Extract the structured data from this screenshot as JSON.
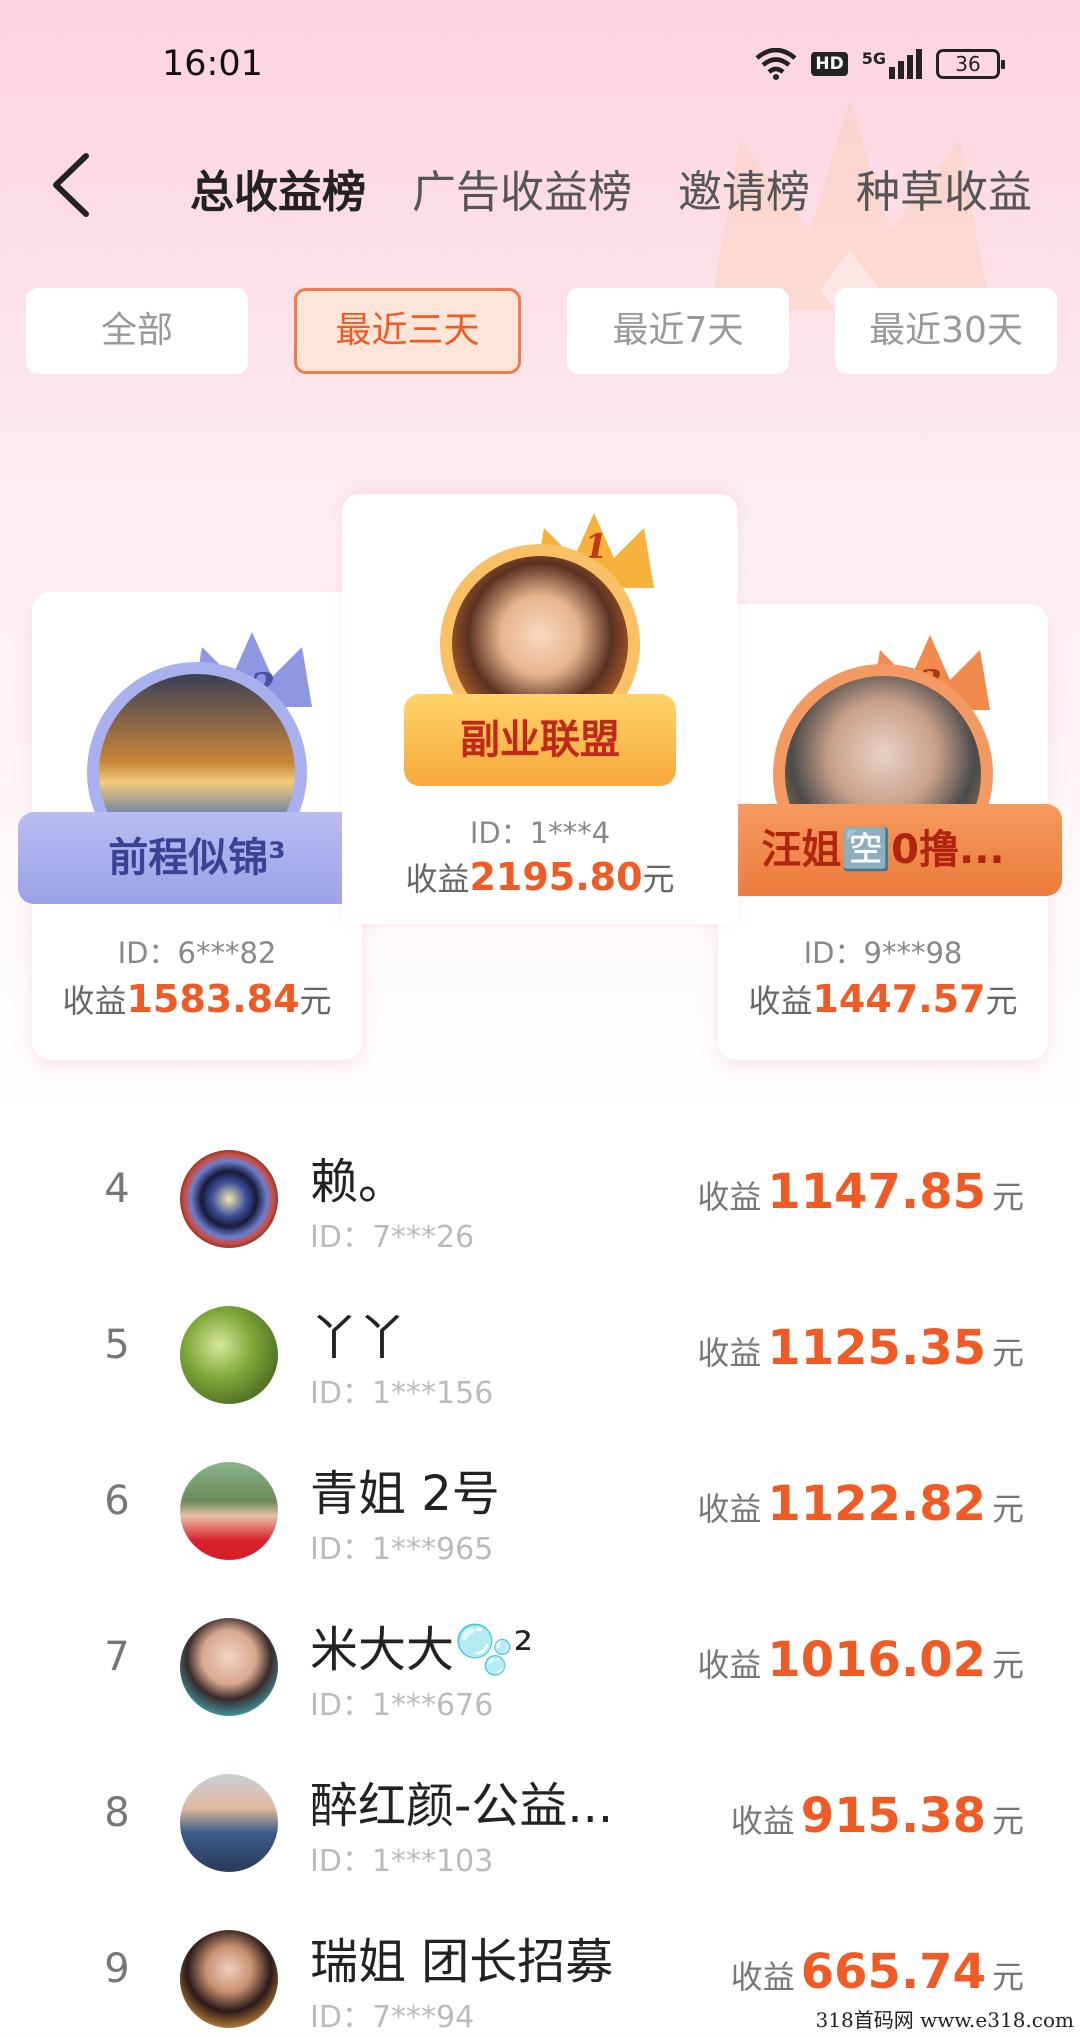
{
  "status": {
    "time": "16:01",
    "network": "5G",
    "hd": "HD",
    "battery": "36"
  },
  "tabs": [
    "总收益榜",
    "广告收益榜",
    "邀请榜",
    "种草收益"
  ],
  "filters": [
    "全部",
    "最近三天",
    "最近7天",
    "最近30天"
  ],
  "podium": {
    "first": {
      "rank": "1",
      "name": "副业联盟",
      "id": "ID：1***4",
      "earn_label": "收益",
      "earn": "2195.80",
      "unit": "元"
    },
    "second": {
      "rank": "2",
      "name": "前程似锦³",
      "id": "ID：6***82",
      "earn_label": "收益",
      "earn": "1583.84",
      "unit": "元"
    },
    "third": {
      "rank": "3",
      "name": "汪姐🈳0撸...",
      "id": "ID：9***98",
      "earn_label": "收益",
      "earn": "1447.57",
      "unit": "元"
    }
  },
  "list": [
    {
      "rank": "4",
      "name": "赖。",
      "id": "ID：7***26",
      "earn_label": "收益",
      "earn": "1147.85",
      "unit": "元"
    },
    {
      "rank": "5",
      "name": "丫丫",
      "id": "ID：1***156",
      "earn_label": "收益",
      "earn": "1125.35",
      "unit": "元"
    },
    {
      "rank": "6",
      "name": "青姐 2号",
      "id": "ID：1***965",
      "earn_label": "收益",
      "earn": "1122.82",
      "unit": "元"
    },
    {
      "rank": "7",
      "name": "米大大🫧²",
      "id": "ID：1***676",
      "earn_label": "收益",
      "earn": "1016.02",
      "unit": "元"
    },
    {
      "rank": "8",
      "name": "醉红颜-公益...",
      "id": "ID：1***103",
      "earn_label": "收益",
      "earn": "915.38",
      "unit": "元"
    },
    {
      "rank": "9",
      "name": "瑞姐 团长招募",
      "id": "ID：7***94",
      "earn_label": "收益",
      "earn": "665.74",
      "unit": "元"
    }
  ],
  "watermark": "318首码网  www.e318.com",
  "colors": {
    "accent": "#f05a24",
    "gold": "#f7b23a",
    "silver": "#9aa2e6",
    "bronze": "#f08a4a"
  }
}
